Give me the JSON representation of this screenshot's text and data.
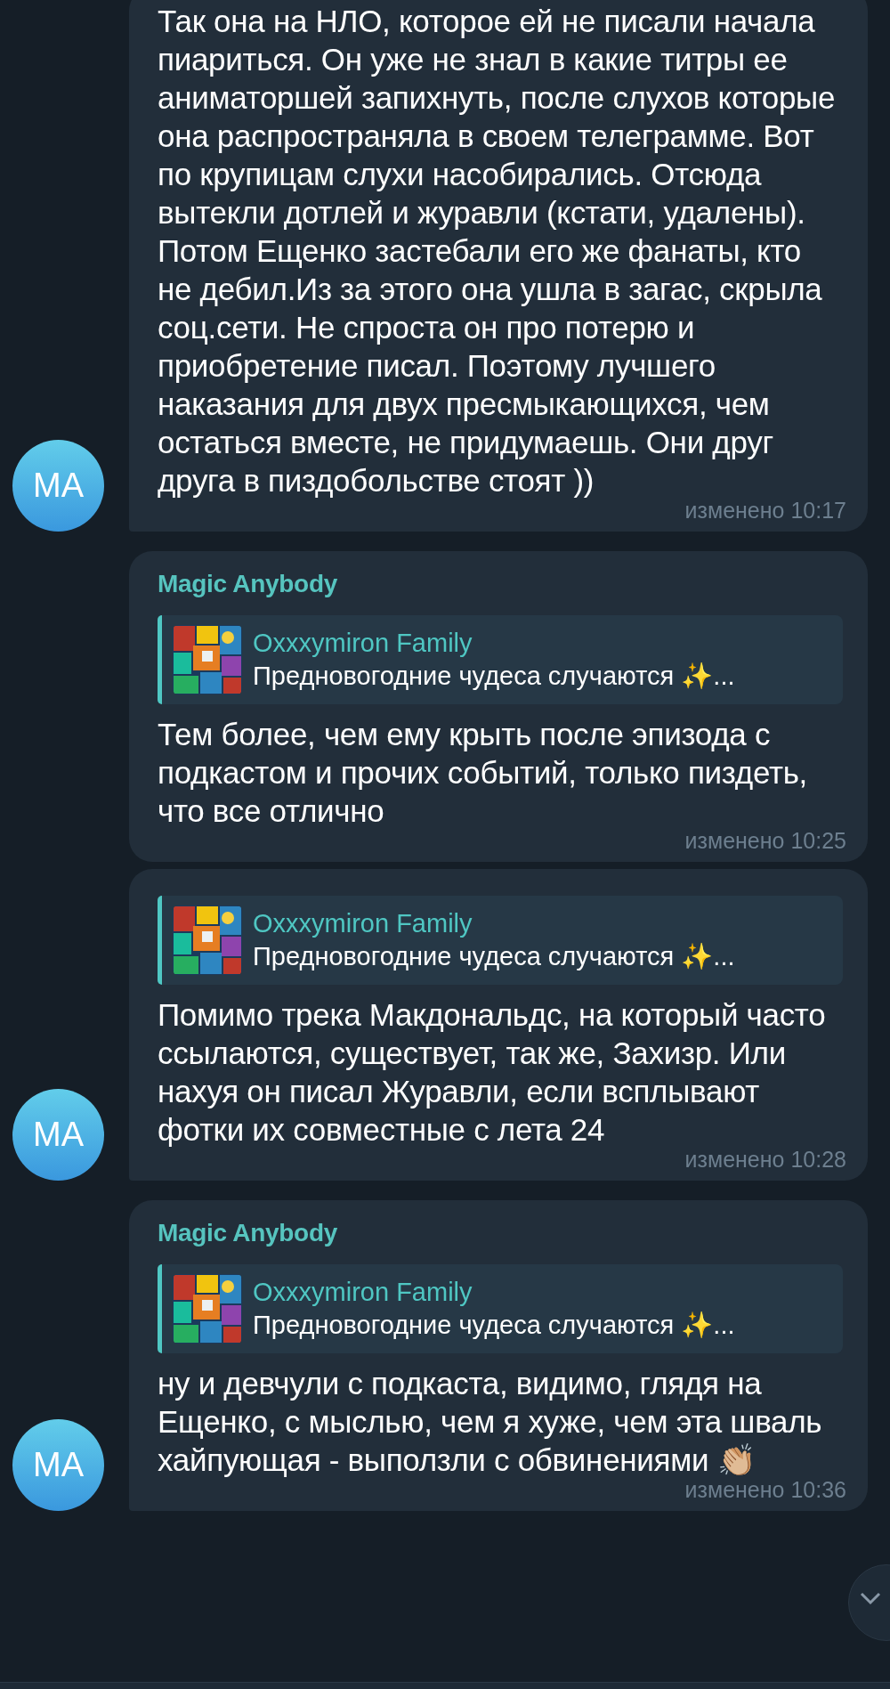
{
  "messages": [
    {
      "text": "Так она на НЛО, которое ей не писали начала пиариться. Он уже не знал в какие титры ее аниматоршей запихнуть, после слухов которые она распространяла в своем телеграмме. Вот по крупицам слухи насобирались. Отсюда вытекли дотлей и журавли (кстати, удалены). Потом Ещенко застебали его же фанаты, кто не дебил.Из за этого она ушла в загас, скрыла соц.сети. Не спроста он про потерю и приобретение писал. Поэтому лучшего наказания для двух пресмыкающихся, чем остаться вместе, не придумаешь. Они друг друга в пиздобольстве стоят ))",
      "time": "изменено 10:17",
      "avatar": "MA"
    },
    {
      "sender": "Magic Anybody",
      "reply": {
        "title": "Oxxxymiron Family",
        "text": "Предновогодние чудеса случаются ✨..."
      },
      "text": "Тем более, чем ему крыть после эпизода с подкастом и прочих событий, только пиздеть, что все отлично",
      "time": "изменено 10:25"
    },
    {
      "reply": {
        "title": "Oxxxymiron Family",
        "text": "Предновогодние чудеса случаются ✨..."
      },
      "text": "Помимо трека Макдональдс, на который часто ссылаются, существует, так же, Захизр. Или нахуя он писал Журавли, если всплывают фотки их совместные с лета 24",
      "time": "изменено 10:28",
      "avatar": "MA"
    },
    {
      "sender": "Magic Anybody",
      "reply": {
        "title": "Oxxxymiron Family",
        "text": "Предновогодние чудеса случаются ✨..."
      },
      "text": "ну и девчули с подкаста, видимо, глядя на Ещенко, с мыслью, чем я хуже, чем эта шваль хайпующая - выползли с обвинениями 👏🏼",
      "time": "изменено 10:36",
      "avatar": "MA"
    }
  ]
}
